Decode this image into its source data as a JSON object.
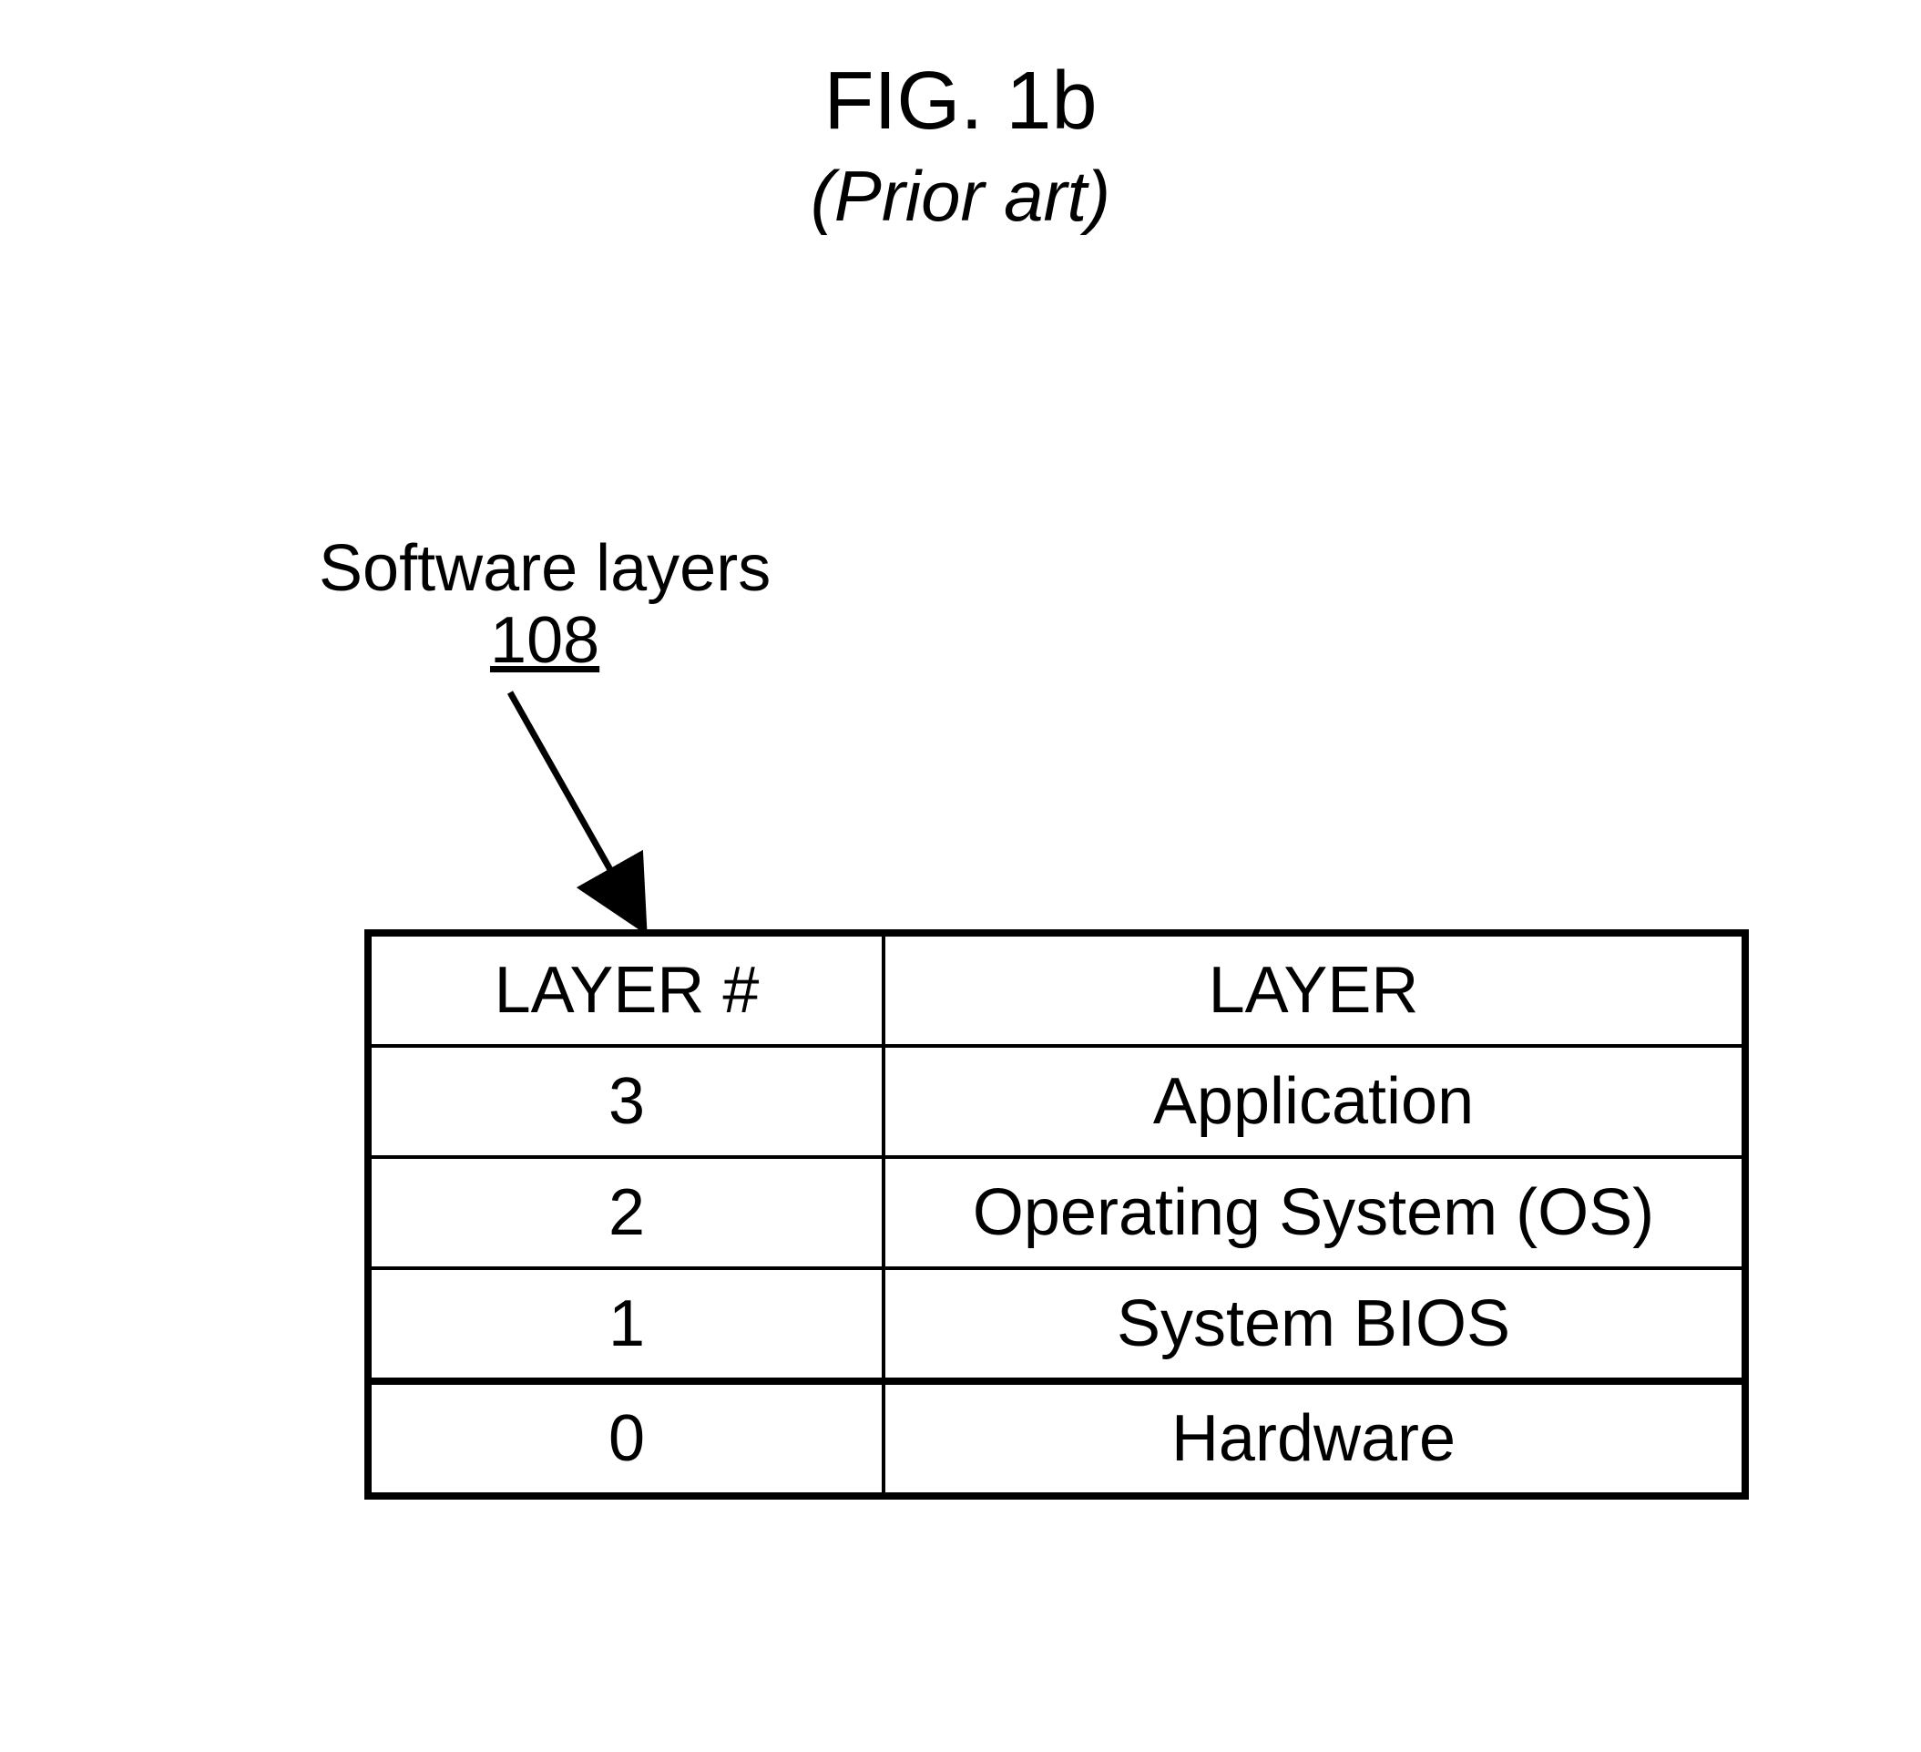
{
  "figure": {
    "title": "FIG. 1b",
    "subtitle": "(Prior art)"
  },
  "annotation": {
    "label": "Software layers",
    "ref": "108"
  },
  "table": {
    "headers": {
      "col1": "LAYER #",
      "col2": "LAYER"
    },
    "rows": [
      {
        "num": "3",
        "name": "Application"
      },
      {
        "num": "2",
        "name": "Operating System (OS)"
      },
      {
        "num": "1",
        "name": "System BIOS"
      },
      {
        "num": "0",
        "name": "Hardware"
      }
    ]
  }
}
